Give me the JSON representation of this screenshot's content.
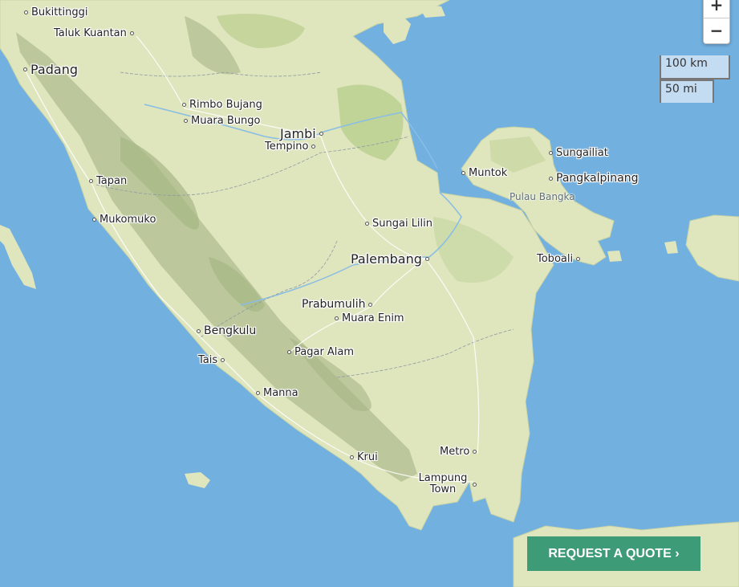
{
  "map": {
    "zoom_in": "+",
    "zoom_out": "−",
    "scale_km": "100 km",
    "scale_mi": "50 mi",
    "cta": "REQUEST A QUOTE ›",
    "region_labels": {
      "bangka": "Pulau Bangka"
    },
    "cities": {
      "bukittinggi": "Bukittinggi",
      "taluk_kuantan": "Taluk Kuantan",
      "padang": "Padang",
      "rimbo_bujang": "Rimbo Bujang",
      "muara_bungo": "Muara Bungo",
      "jambi": "Jambi",
      "tempino": "Tempino",
      "tapan": "Tapan",
      "mukomuko": "Mukomuko",
      "sungai_lilin": "Sungai Lilin",
      "palembang": "Palembang",
      "prabumulih": "Prabumulih",
      "muara_enim": "Muara Enim",
      "bengkulu": "Bengkulu",
      "tais": "Tais",
      "pagar_alam": "Pagar Alam",
      "manna": "Manna",
      "krui": "Krui",
      "metro": "Metro",
      "lampung_town": "Lampung Town",
      "muntok": "Muntok",
      "sungailiat": "Sungailiat",
      "pangkalpinang": "Pangkalpinang",
      "toboali": "Toboali"
    },
    "colors": {
      "sea": "#72b0e0",
      "land": "#dfe5bd",
      "mountain": "#a8b98a",
      "forest": "#b9cf8e"
    }
  }
}
